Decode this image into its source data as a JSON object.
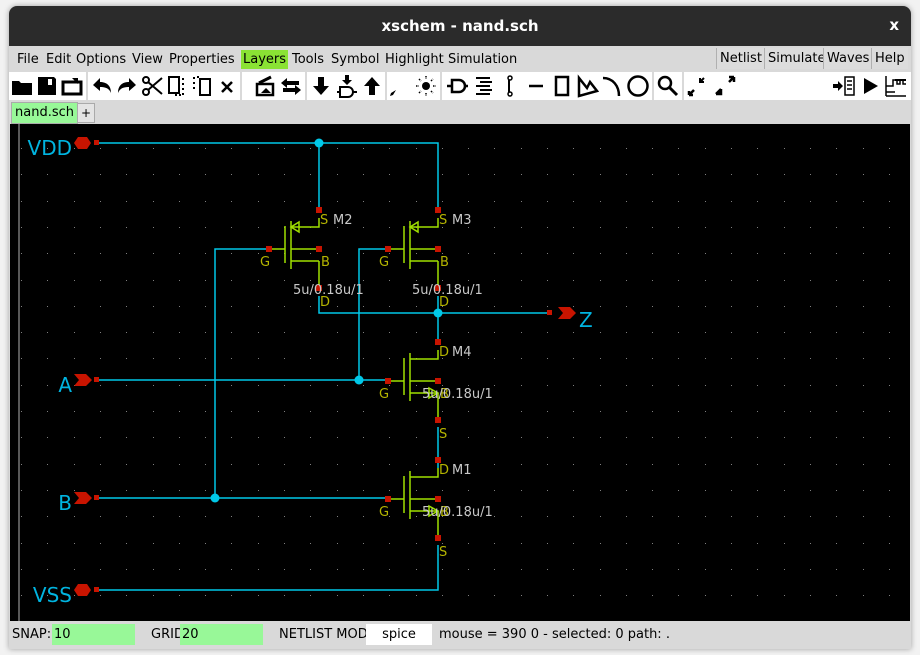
{
  "window": {
    "title": "xschem - nand.sch",
    "close_label": "x"
  },
  "menu": {
    "items": [
      "File",
      "Edit",
      "Options",
      "View",
      "Properties",
      "Layers",
      "Tools",
      "Symbol",
      "Highlight",
      "Simulation"
    ],
    "active": "Layers",
    "right_buttons": [
      "Netlist",
      "Simulate",
      "Waves",
      "Help"
    ]
  },
  "toolbar": {
    "icons": [
      "open-icon",
      "save-icon",
      "reload-icon",
      "undo-icon",
      "redo-icon",
      "cut-icon",
      "copy-icon",
      "move-icon",
      "delete-icon",
      "push-schematic-icon",
      "swap-icon",
      "descend-icon",
      "insert-symbol-icon",
      "ascend-icon",
      "wire-icon",
      "highlight-icon",
      "pin-icon",
      "text-icon",
      "net-label-icon",
      "line-icon",
      "rect-icon",
      "polygon-icon",
      "arc-icon",
      "circle-icon",
      "zoom-icon",
      "zoom-full-icon",
      "zoom-fit-icon",
      "netlist-icon",
      "simulate-icon",
      "waves-icon"
    ]
  },
  "tabs": {
    "items": [
      "nand.sch"
    ],
    "add_label": "+"
  },
  "schematic": {
    "pins": [
      {
        "name": "VDD",
        "dir": "in"
      },
      {
        "name": "A",
        "dir": "in"
      },
      {
        "name": "B",
        "dir": "in"
      },
      {
        "name": "VSS",
        "dir": "in"
      },
      {
        "name": "Z",
        "dir": "out"
      }
    ],
    "transistors": [
      {
        "name": "M2",
        "type": "pmos",
        "size": "5u/0.18u/1",
        "terminals": {
          "s": "S",
          "g": "G",
          "b": "B",
          "d": "D"
        }
      },
      {
        "name": "M3",
        "type": "pmos",
        "size": "5u/0.18u/1",
        "terminals": {
          "s": "S",
          "g": "G",
          "b": "B",
          "d": "D"
        }
      },
      {
        "name": "M4",
        "type": "nmos",
        "size": "5u/0.18u/1",
        "terminals": {
          "s": "S",
          "g": "G",
          "b": "B",
          "d": "D"
        }
      },
      {
        "name": "M1",
        "type": "nmos",
        "size": "5u/0.18u/1",
        "terminals": {
          "s": "S",
          "g": "G",
          "b": "B",
          "d": "D"
        }
      }
    ],
    "colors": {
      "background": "#000000",
      "wire": "#00c8e8",
      "pin": "#c81400",
      "device": "#a0e000",
      "pin_label": "#b4b400",
      "inst_label": "#c8c8c8",
      "grid": "#808080",
      "node_label": "#00b4e0"
    }
  },
  "status": {
    "snap_label": "SNAP:",
    "snap_value": "10",
    "grid_label": "GRID:",
    "grid_value": "20",
    "netlist_mode_label": "NETLIST MODE:",
    "netlist_mode_value": "spice",
    "info": "mouse = 390 0 - selected: 0 path: ."
  }
}
